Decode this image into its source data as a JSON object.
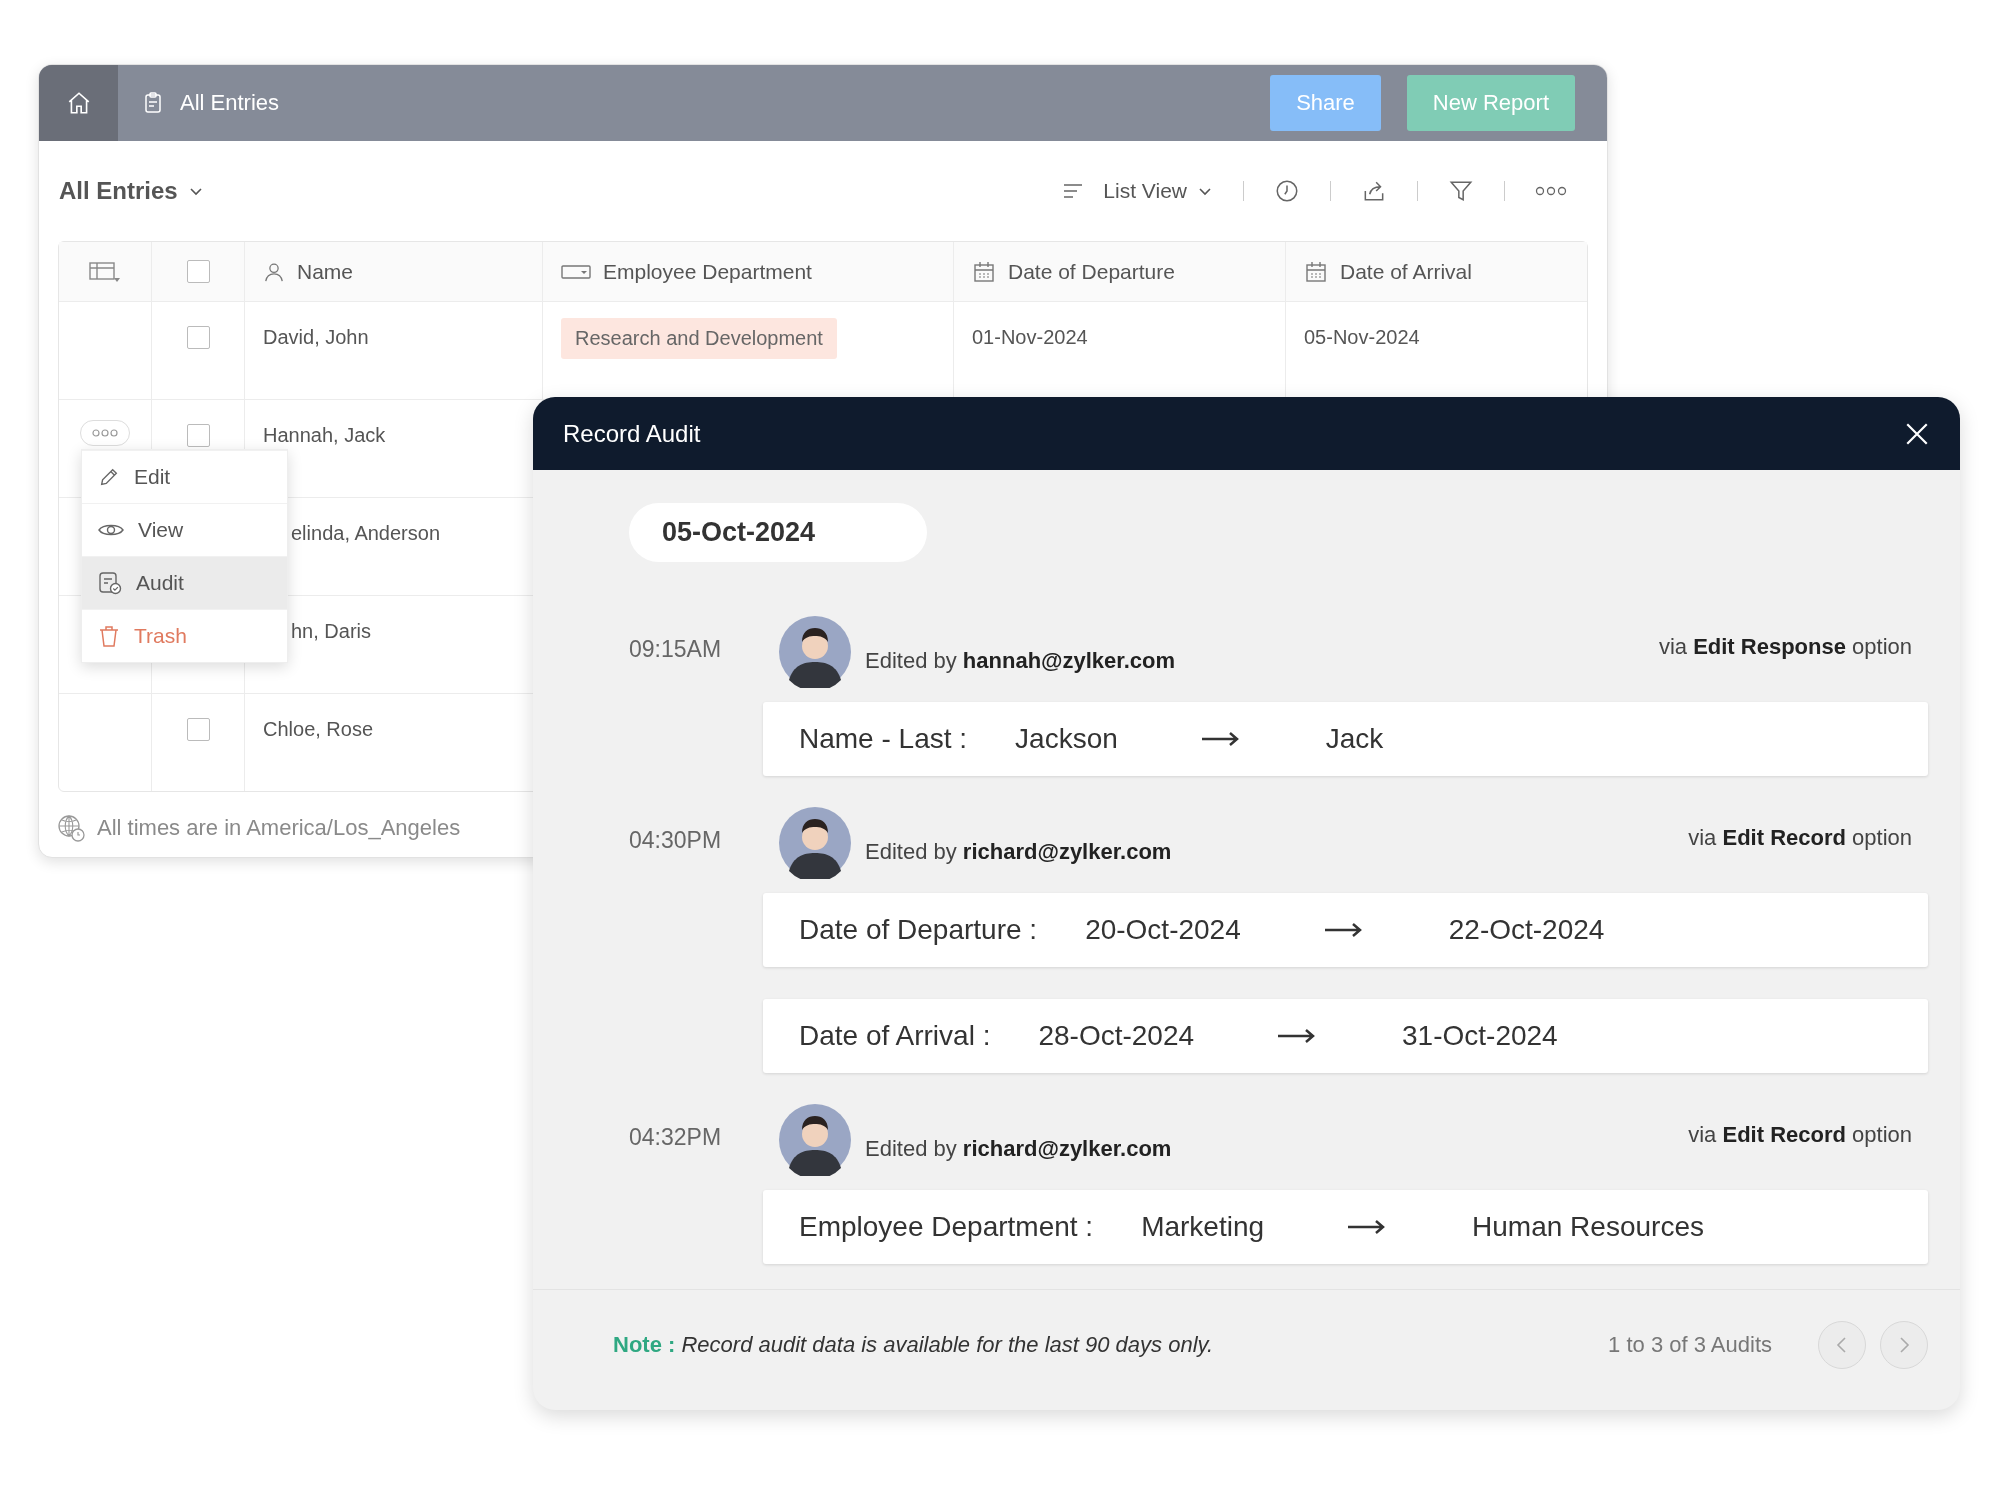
{
  "app_bar": {
    "title": "All Entries",
    "buttons": [
      {
        "label": "Share",
        "kind": "share"
      },
      {
        "label": "New Report",
        "kind": "report"
      }
    ]
  },
  "toolbar": {
    "view_title": "All Entries",
    "view_mode": "List View"
  },
  "table": {
    "columns": [
      "Name",
      "Employee Department",
      "Date of Departure",
      "Date of Arrival"
    ],
    "header_checked": false,
    "rows": [
      {
        "checked": false,
        "name": "David, John",
        "department": "Research and Development",
        "departure": "01-Nov-2024",
        "arrival": "05-Nov-2024"
      },
      {
        "checked": false,
        "name": "Hannah, Jack",
        "more": true
      },
      {
        "name": "elinda, Anderson",
        "covered": true
      },
      {
        "name": "hn, Daris",
        "covered": true
      },
      {
        "checked": false,
        "name": "Chloe, Rose"
      }
    ]
  },
  "row_menu": [
    {
      "label": "Edit",
      "kind": "edit",
      "selected": false
    },
    {
      "label": "View",
      "kind": "view",
      "selected": false
    },
    {
      "label": "Audit",
      "kind": "audit",
      "selected": true
    },
    {
      "label": "Trash",
      "kind": "trash",
      "selected": false
    }
  ],
  "timezone_note": "All times are in America/Los_Angeles",
  "audit": {
    "title": "Record Audit",
    "date": "05-Oct-2024",
    "entries": [
      {
        "time": "09:15AM",
        "editor": "Edited by **hannah@zylker.com**",
        "via": "via **Edit Response** option",
        "changes": [
          {
            "field": "Name - Last :",
            "from": "Jackson",
            "to": "Jack"
          }
        ]
      },
      {
        "time": "04:30PM",
        "editor": "Edited by **richard@zylker.com**",
        "via": "via **Edit Record** option",
        "changes": [
          {
            "field": "Date of Departure :",
            "from": "20-Oct-2024",
            "to": "22-Oct-2024"
          },
          {
            "field": "Date of Arrival :",
            "from": "28-Oct-2024",
            "to": "31-Oct-2024"
          }
        ]
      },
      {
        "time": "04:32PM",
        "editor": "Edited by **richard@zylker.com**",
        "via": "via **Edit Record** option",
        "changes": [
          {
            "field": "Employee Department :",
            "from": "Marketing",
            "to": "Human Resources"
          }
        ]
      }
    ],
    "note_label": "Note :",
    "note": "Record audit data is available for the last 90 days only.",
    "count": "1 to 3 of 3 Audits"
  }
}
